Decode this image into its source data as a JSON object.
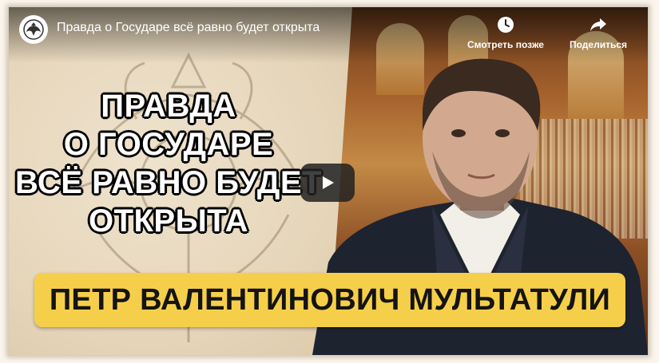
{
  "video": {
    "title": "Правда о Государе всё равно будет открыта",
    "watch_later_label": "Смотреть позже",
    "share_label": "Поделиться"
  },
  "thumbnail": {
    "title_lines": [
      "ПРАВДА",
      "О ГОСУДАРЕ",
      "ВСЁ РАВНО БУДЕТ",
      "ОТКРЫТА"
    ],
    "banner_text": "ПЕТР ВАЛЕНТИНОВИЧ МУЛЬТАТУЛИ"
  },
  "colors": {
    "banner": "#f6cf4a",
    "banner_text": "#141414",
    "title_text": "#ffffff",
    "title_outline": "#000000"
  },
  "icons": [
    "channel-emblem-icon",
    "watch-later-clock-icon",
    "share-arrow-icon",
    "play-icon"
  ]
}
